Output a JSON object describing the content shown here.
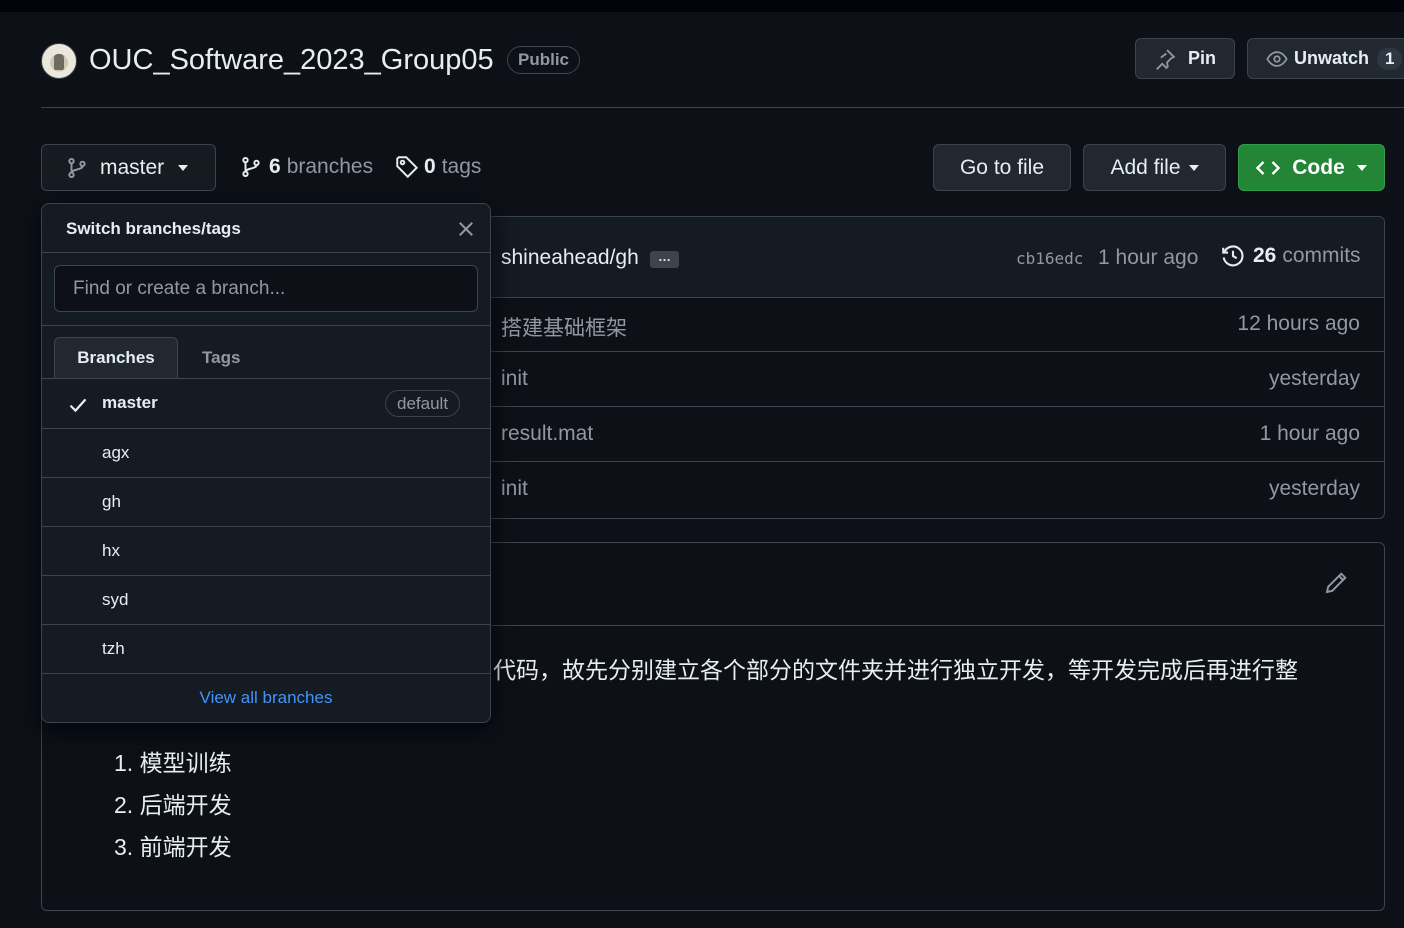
{
  "repo": {
    "name": "OUC_Software_2023_Group05",
    "visibility": "Public",
    "pin_label": "Pin",
    "unwatch_label": "Unwatch",
    "watch_count": "1"
  },
  "toolbar": {
    "current_branch": "master",
    "branches_count": "6",
    "branches_label": "branches",
    "tags_count": "0",
    "tags_label": "tags",
    "go_to_file": "Go to file",
    "add_file": "Add file",
    "code": "Code"
  },
  "latest_commit": {
    "message": "shineahead/gh",
    "ellipsis": "…",
    "sha": "cb16edc",
    "time": "1 hour ago",
    "commits_count": "26",
    "commits_label": "commits"
  },
  "files": [
    {
      "message": "搭建基础框架",
      "time": "12 hours ago"
    },
    {
      "message": "init",
      "time": "yesterday"
    },
    {
      "message": "result.mat",
      "time": "1 hour ago"
    },
    {
      "message": "init",
      "time": "yesterday"
    }
  ],
  "readme": {
    "text": "代码，故先分别建立各个部分的文件夹并进行独立开发，等开发完成后再进行整",
    "list": [
      "1. 模型训练",
      "2. 后端开发",
      "3. 前端开发"
    ]
  },
  "dropdown": {
    "title": "Switch branches/tags",
    "search_placeholder": "Find or create a branch...",
    "tab_branches": "Branches",
    "tab_tags": "Tags",
    "branches": [
      {
        "name": "master",
        "badge": "default",
        "selected": true
      },
      {
        "name": "agx"
      },
      {
        "name": "gh"
      },
      {
        "name": "hx"
      },
      {
        "name": "syd"
      },
      {
        "name": "tzh"
      }
    ],
    "view_all": "View all branches"
  },
  "colors": {
    "background": "#0d1117",
    "border": "#3d444d",
    "muted_text": "#9198a1",
    "code_button": "#238636",
    "link": "#4493f8"
  },
  "icons": [
    "pin-icon",
    "eye-icon",
    "git-branch-icon",
    "tag-icon",
    "history-icon",
    "code-icon",
    "pencil-icon",
    "close-icon",
    "check-icon"
  ]
}
